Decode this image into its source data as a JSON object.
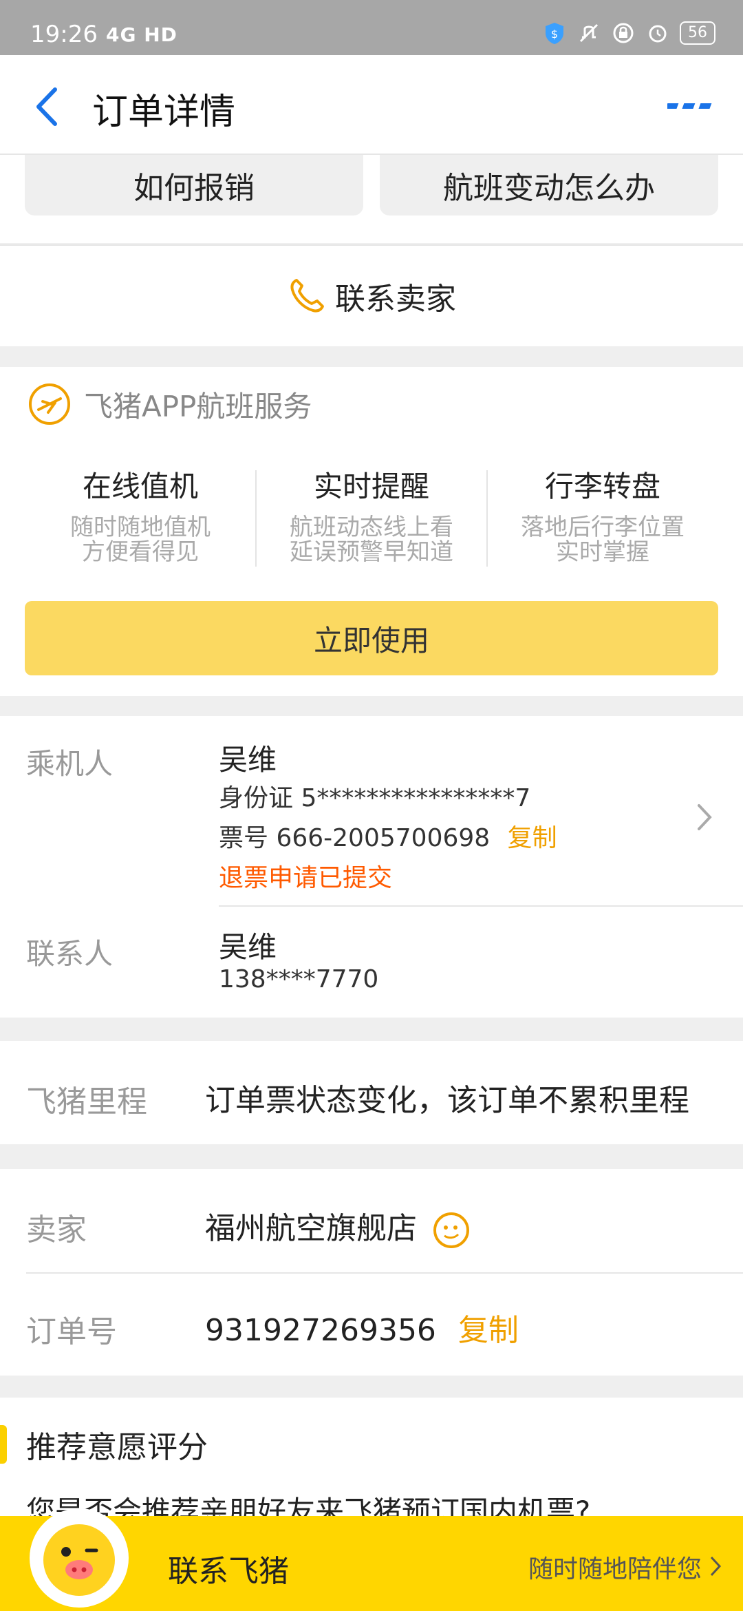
{
  "status_bar": {
    "time": "19:26",
    "network": "4G HD",
    "battery": "56"
  },
  "nav": {
    "title": "订单详情"
  },
  "quick_actions": {
    "reimburse": "如何报销",
    "flight_change": "航班变动怎么办"
  },
  "contact_seller": {
    "label": "联系卖家"
  },
  "service": {
    "header": "飞猪APP航班服务",
    "features": [
      {
        "title": "在线值机",
        "desc1": "随时随地值机",
        "desc2": "方便看得见"
      },
      {
        "title": "实时提醒",
        "desc1": "航班动态线上看",
        "desc2": "延误预警早知道"
      },
      {
        "title": "行李转盘",
        "desc1": "落地后行李位置",
        "desc2": "实时掌握"
      }
    ],
    "use_button": "立即使用"
  },
  "passenger": {
    "label": "乘机人",
    "name": "吴维",
    "id_line": "身份证 5****************7",
    "ticket_line": "票号 666-2005700698",
    "copy": "复制",
    "refund_status": "退票申请已提交"
  },
  "contact": {
    "label": "联系人",
    "name": "吴维",
    "phone": "138****7770"
  },
  "mileage": {
    "label": "飞猪里程",
    "value": "订单票状态变化，该订单不累积里程"
  },
  "seller": {
    "label": "卖家",
    "value": "福州航空旗舰店"
  },
  "order": {
    "label": "订单号",
    "value": "931927269356",
    "copy": "复制"
  },
  "recommend": {
    "title": "推荐意愿评分",
    "question": "您是否会推荐亲朋好友来飞猪预订国内机票?"
  },
  "bottom": {
    "label": "联系飞猪",
    "sub": "随时随地陪伴您"
  },
  "colors": {
    "accent": "#f0a000",
    "primary_blue": "#1a73e8",
    "cta_yellow": "#fbd961",
    "bottom_yellow": "#ffd600",
    "refund_orange": "#ff5a00"
  }
}
